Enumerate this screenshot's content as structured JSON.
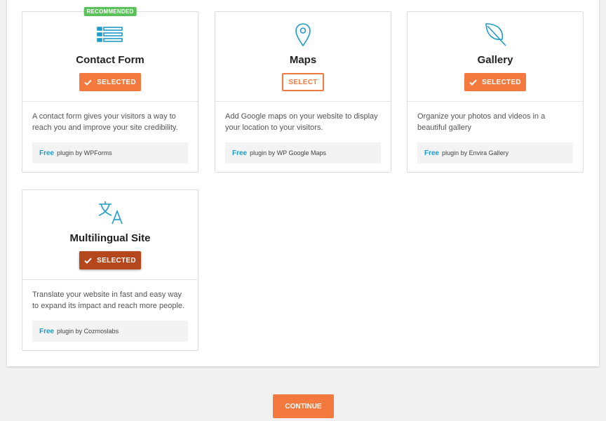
{
  "colors": {
    "accent": "#f4793e",
    "accent_dark": "#b4481c",
    "icon_blue": "#1e9bc9",
    "badge_green": "#5ac15a"
  },
  "cards": [
    {
      "title": "Contact Form",
      "icon": "form-list-icon",
      "badge": "RECOMMENDED",
      "button_label": "SELECTED",
      "button_state": "selected",
      "description": "A contact form gives your visitors a way to reach you and improve your site credibility.",
      "plugin_free": "Free",
      "plugin_text": "plugin by WPForms"
    },
    {
      "title": "Maps",
      "icon": "map-pin-icon",
      "button_label": "SELECT",
      "button_state": "unselected",
      "description": "Add Google maps on your website to display your location to your visitors.",
      "plugin_free": "Free",
      "plugin_text": "plugin by WP Google Maps"
    },
    {
      "title": "Gallery",
      "icon": "leaf-icon",
      "button_label": "SELECTED",
      "button_state": "selected",
      "description": "Organize your photos and videos in a beautiful gallery",
      "plugin_free": "Free",
      "plugin_text": "plugin by Envira Gallery"
    },
    {
      "title": "Multilingual Site",
      "icon": "translate-icon",
      "button_label": "SELECTED",
      "button_state": "selected-hover",
      "description": "Translate your website in fast and easy way to expand its impact and reach more people.",
      "plugin_free": "Free",
      "plugin_text": "plugin by Cozmoslabs"
    }
  ],
  "continue_label": "CONTINUE"
}
